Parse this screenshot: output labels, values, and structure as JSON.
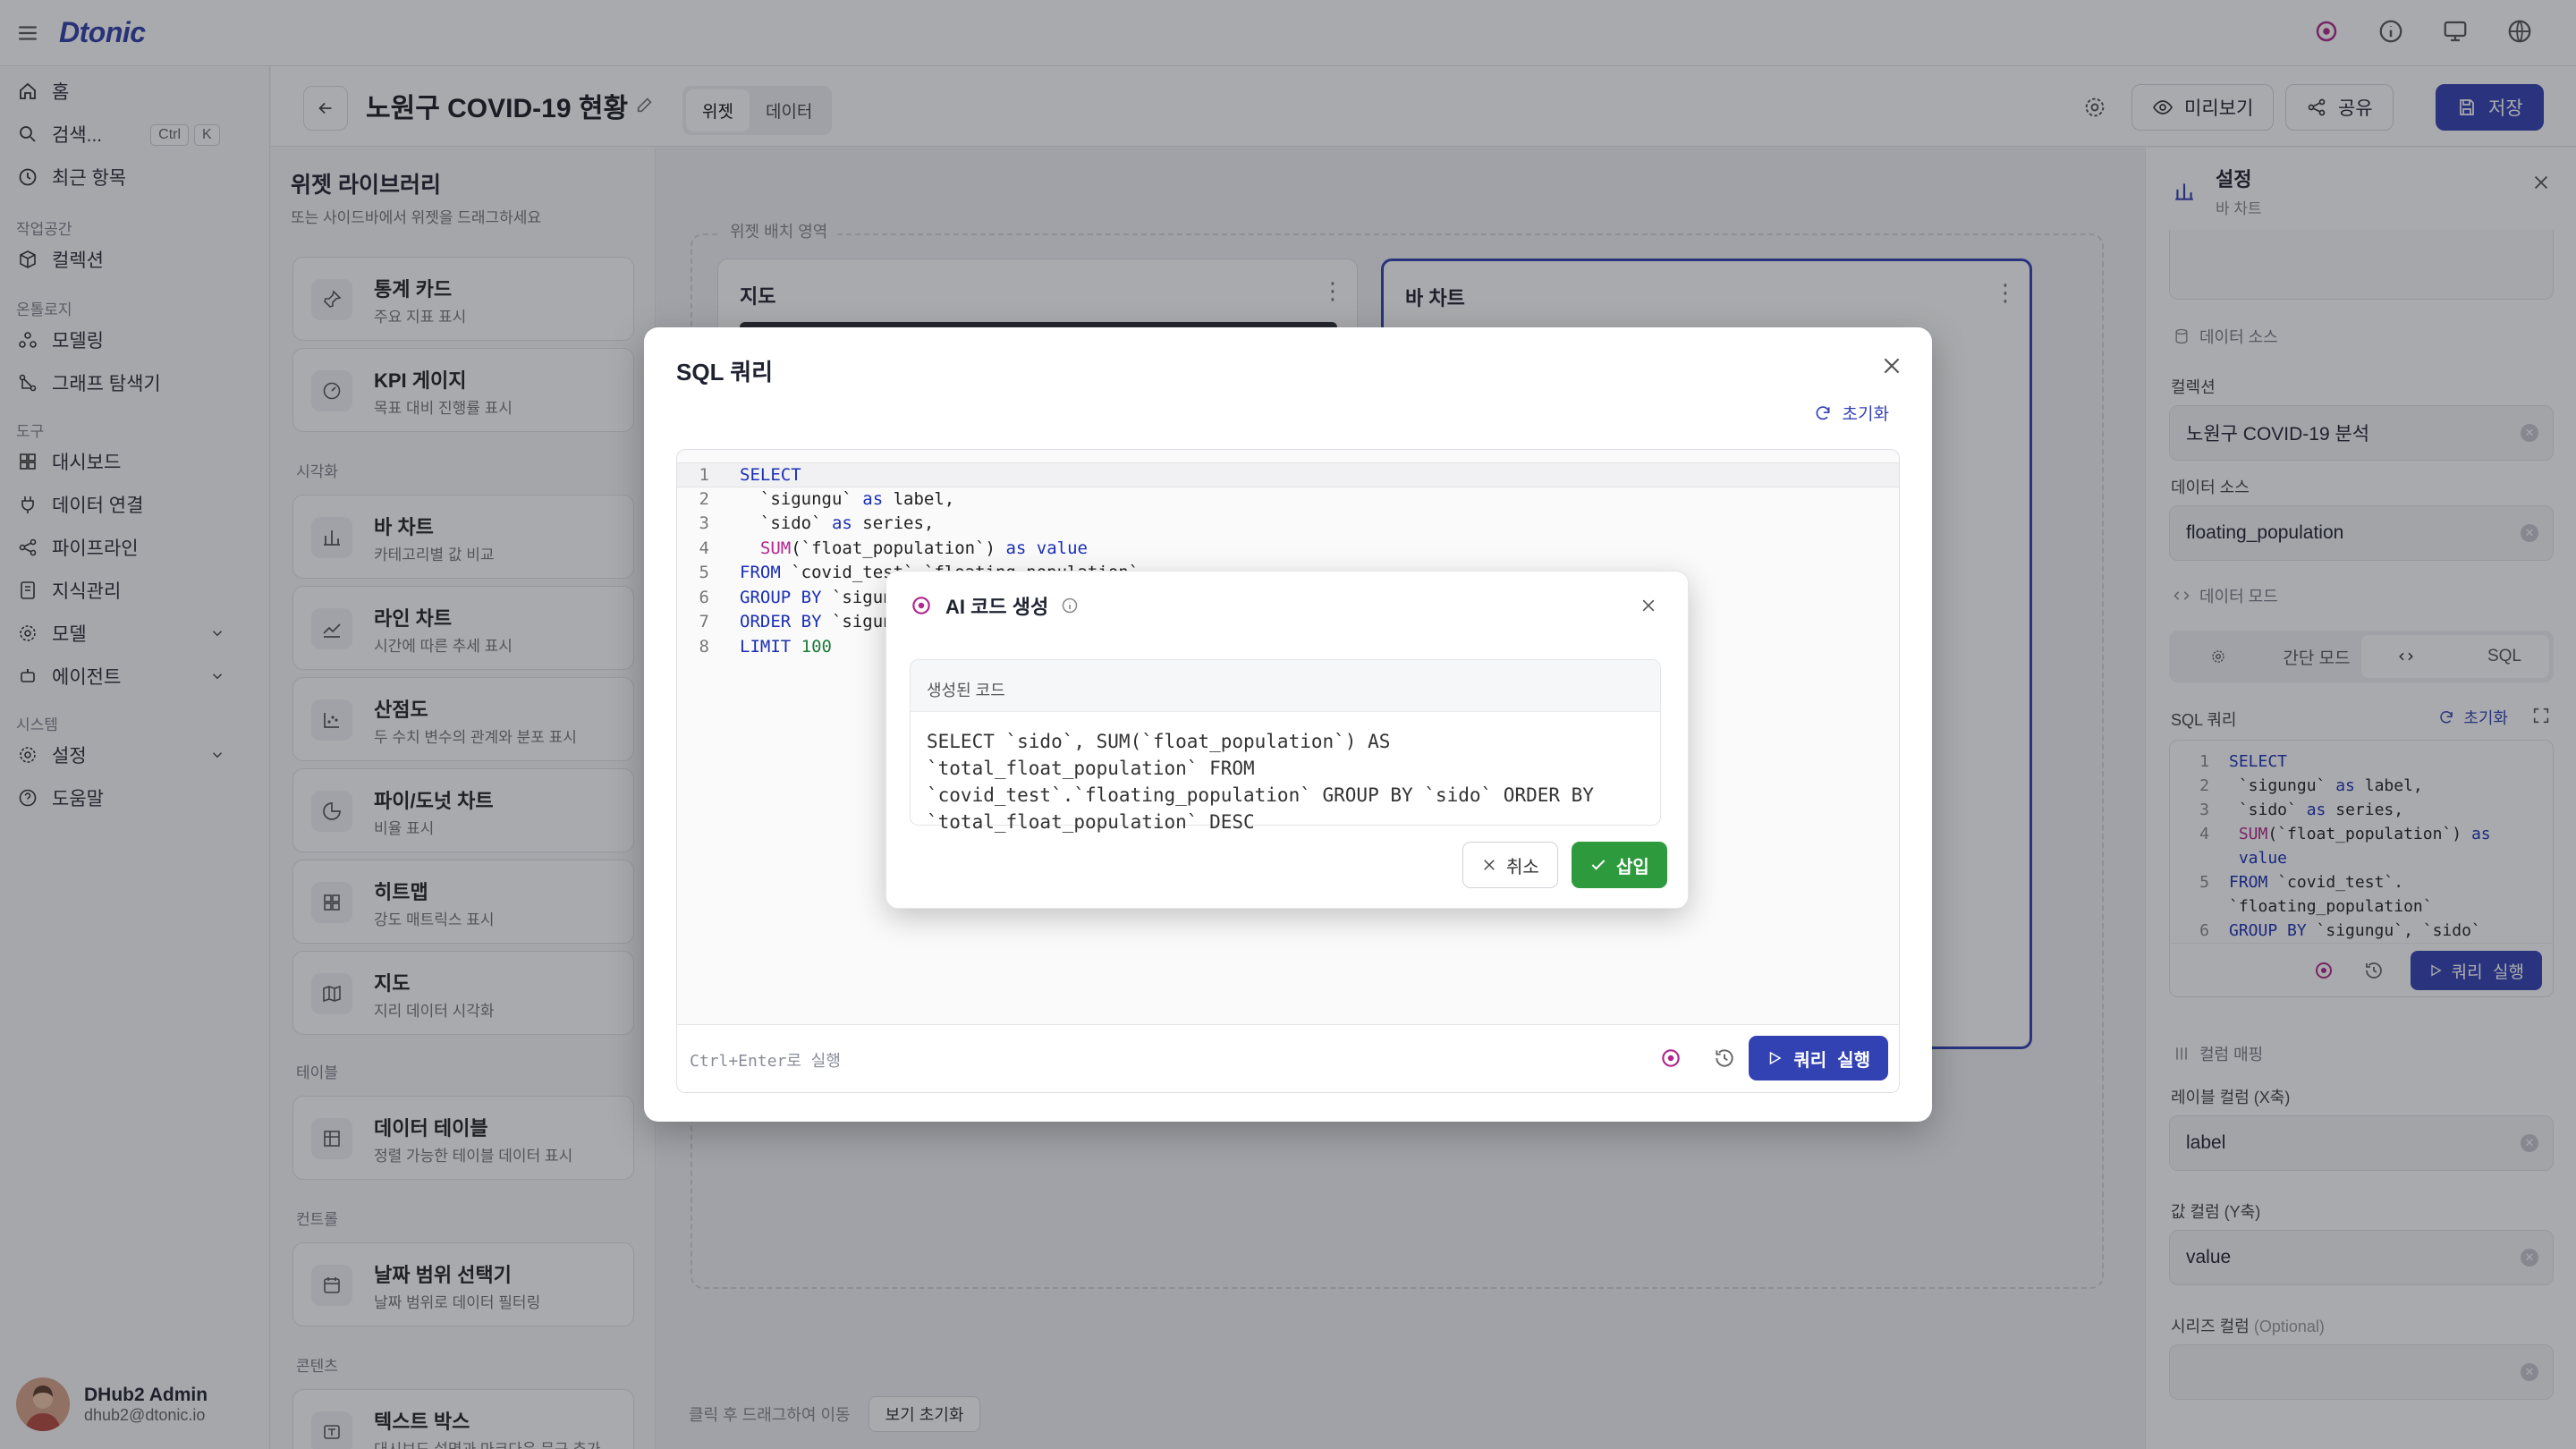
{
  "app": {
    "logo": "Dtonic"
  },
  "sidebar": {
    "home": "홈",
    "search": "검색...",
    "search_kbd_1": "Ctrl",
    "search_kbd_2": "K",
    "recent": "최근 항목",
    "section_workspace": "작업공간",
    "collection": "컬렉션",
    "section_ontology": "온톨로지",
    "modeling": "모델링",
    "graph_explorer": "그래프 탐색기",
    "section_tools": "도구",
    "dashboard": "대시보드",
    "data_connect": "데이터 연결",
    "pipeline": "파이프라인",
    "knowledge": "지식관리",
    "model": "모델",
    "agent": "에이전트",
    "section_system": "시스템",
    "settings": "설정",
    "help": "도움말",
    "user_name": "DHub2 Admin",
    "user_email": "dhub2@dtonic.io"
  },
  "header": {
    "title": "노원구 COVID-19 현황",
    "tab_widget": "위젯",
    "tab_data": "데이터",
    "preview": "미리보기",
    "share": "공유",
    "save": "저장"
  },
  "library": {
    "title": "위젯 라이브러리",
    "subtitle": "또는 사이드바에서 위젯을 드래그하세요",
    "groups": {
      "visual": "시각화",
      "table": "테이블",
      "control": "컨트롤",
      "content": "콘텐츠"
    },
    "cards": [
      {
        "title": "통계 카드",
        "sub": "주요 지표 표시"
      },
      {
        "title": "KPI 게이지",
        "sub": "목표 대비 진행률 표시"
      },
      {
        "title": "바 차트",
        "sub": "카테고리별 값 비교"
      },
      {
        "title": "라인 차트",
        "sub": "시간에 따른 추세 표시"
      },
      {
        "title": "산점도",
        "sub": "두 수치 변수의 관계와 분포 표시"
      },
      {
        "title": "파이/도넛 차트",
        "sub": "비율 표시"
      },
      {
        "title": "히트맵",
        "sub": "강도 매트릭스 표시"
      },
      {
        "title": "지도",
        "sub": "지리 데이터 시각화"
      },
      {
        "title": "데이터 테이블",
        "sub": "정렬 가능한 테이블 데이터 표시"
      },
      {
        "title": "날짜 범위 선택기",
        "sub": "날짜 범위로 데이터 필터링"
      },
      {
        "title": "텍스트 박스",
        "sub": "대시보드 설명과 마크다운 문구 추가"
      }
    ]
  },
  "canvas": {
    "zone_label": "위젯 배치 영역",
    "widget_map": "지도",
    "widget_bar": "바 차트",
    "hint": "클릭 후 드래그하여 이동",
    "reset_view": "보기 초기화"
  },
  "settings_panel": {
    "title": "설정",
    "subtitle": "바 차트",
    "sec_data_source": "데이터 소스",
    "collection_label": "컬렉션",
    "collection_value": "노원구 COVID-19 분석",
    "source_label": "데이터 소스",
    "source_value": "floating_population",
    "sec_data_mode": "데이터 모드",
    "mode_simple": "간단 모드",
    "mode_sql": "SQL",
    "sql_label": "SQL 쿼리",
    "sql_reset": "초기화",
    "run": "쿼리 실행",
    "sec_mapping": "컬럼 매핑",
    "label_col_label": "레이블 컬럼 (X축)",
    "label_col_value": "label",
    "value_col_label": "값 컬럼 (Y축)",
    "value_col_value": "value",
    "series_col_label": "시리즈 컬럼",
    "series_col_optional": "(Optional)"
  },
  "sql_modal": {
    "title": "SQL 쿼리",
    "reset": "초기화",
    "hint": "Ctrl+Enter로 실행",
    "run": "쿼리 실행"
  },
  "ai_dialog": {
    "title": "AI 코드 생성",
    "generated_label": "생성된 코드",
    "generated_code": "SELECT `sido`, SUM(`float_population`) AS `total_float_population` FROM `covid_test`.`floating_population` GROUP BY `sido` ORDER BY `total_float_population` DESC",
    "cancel": "취소",
    "insert": "삽입"
  },
  "colors": {
    "primary": "#3342b3",
    "success": "#2d9a3e",
    "keyword": "#1a2fb5",
    "function": "#b0268c"
  }
}
